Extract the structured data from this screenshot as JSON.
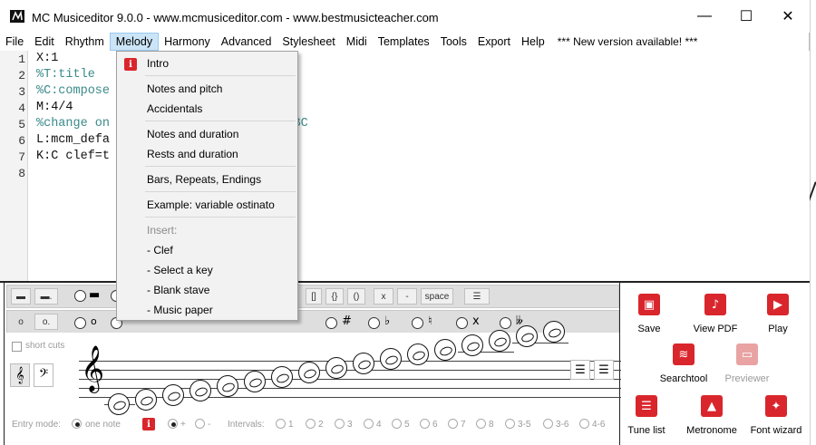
{
  "window": {
    "title": "MC Musiceditor 9.0.0 - www.mcmusiceditor.com - www.bestmusicteacher.com",
    "controls": {
      "minimize": "—",
      "maximize": "☐",
      "close": "✕"
    }
  },
  "menu": {
    "items": [
      "File",
      "Edit",
      "Rhythm",
      "Melody",
      "Harmony",
      "Advanced",
      "Stylesheet",
      "Midi",
      "Templates",
      "Tools",
      "Export",
      "Help"
    ],
    "active": "Melody",
    "notice": "*** New version available! ***"
  },
  "editor": {
    "line_numbers": [
      "1",
      "2",
      "3",
      "4",
      "5",
      "6",
      "7",
      "8"
    ],
    "lines": [
      {
        "text": "X:1",
        "style": "black"
      },
      {
        "text": "%T:title",
        "style": "comment"
      },
      {
        "text": "%C:compose",
        "style": "comment"
      },
      {
        "text": "M:4/4",
        "style": "black"
      },
      {
        "text": "%change on                   sing ABC",
        "style": "comment"
      },
      {
        "text": "L:mcm_defa",
        "style": "black"
      },
      {
        "text": "K:C clef=t",
        "style": "black"
      },
      {
        "text": "",
        "style": "black"
      }
    ]
  },
  "melody_menu": {
    "intro_icon": "i",
    "intro": "Intro",
    "notes_and_pitch": "Notes and pitch",
    "accidentals": "Accidentals",
    "notes_and_duration": "Notes and duration",
    "rests_and_duration": "Rests and duration",
    "bars_repeats_endings": "Bars, Repeats, Endings",
    "example": "Example: variable ostinato",
    "insert_header": "Insert:",
    "clef": "- Clef",
    "select_key": "- Select a key",
    "blank_stave": "- Blank stave",
    "music_paper": "- Music paper"
  },
  "toolbar1": {
    "brackets": [
      "[]",
      "{}",
      "()"
    ],
    "x": "x",
    "dash": "-",
    "space": "space"
  },
  "toolbar2": {
    "accidentals": [
      "#",
      "♭",
      "♮",
      "x",
      "𝄫"
    ]
  },
  "staff_panel": {
    "short_cuts": "short cuts",
    "treble_clef": "𝄞",
    "bass_clef": "𝄢",
    "entry_mode_label": "Entry mode:",
    "one_note": "one note",
    "plus": "+",
    "minus": "-",
    "intervals_label": "Intervals:",
    "intervals": [
      "1",
      "2",
      "3",
      "4",
      "5",
      "6",
      "7",
      "8",
      "3-5",
      "3-6",
      "4-6"
    ]
  },
  "actions": [
    {
      "id": "save",
      "label": "Save",
      "icon": "save-icon",
      "glyph": "▣",
      "enabled": true
    },
    {
      "id": "view-pdf",
      "label": "View PDF",
      "icon": "pdf-icon",
      "glyph": "♪",
      "enabled": true
    },
    {
      "id": "play",
      "label": "Play",
      "icon": "play-icon",
      "glyph": "▶",
      "enabled": true
    },
    {
      "id": "searchtool",
      "label": "Searchtool",
      "icon": "database-icon",
      "glyph": "≋",
      "enabled": true
    },
    {
      "id": "previewer",
      "label": "Previewer",
      "icon": "monitor-icon",
      "glyph": "▭",
      "enabled": false
    },
    {
      "id": "tune-list",
      "label": "Tune list",
      "icon": "list-icon",
      "glyph": "☰",
      "enabled": true
    },
    {
      "id": "metronome",
      "label": "Metronome",
      "icon": "metronome-icon",
      "glyph": "▲",
      "enabled": true
    },
    {
      "id": "font-wizard",
      "label": "Font wizard",
      "icon": "wand-icon",
      "glyph": "✦",
      "enabled": true
    }
  ]
}
